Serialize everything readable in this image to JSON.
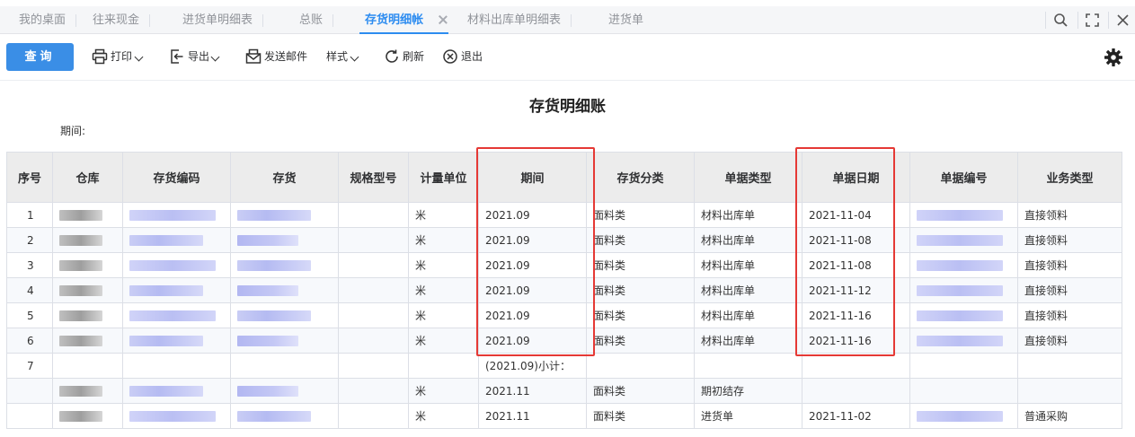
{
  "tabs": [
    {
      "label": "我的桌面"
    },
    {
      "label": "往来现金"
    },
    {
      "label": "进货单明细表"
    },
    {
      "label": "总账"
    },
    {
      "label": "存货明细帐"
    },
    {
      "label": "材料出库单明细表"
    },
    {
      "label": "进货单"
    }
  ],
  "active_tab_index": 4,
  "toolbar": {
    "query": "查询",
    "print": "打印",
    "export": "导出",
    "send_mail": "发送邮件",
    "style": "样式",
    "refresh": "刷新",
    "exit": "退出"
  },
  "report": {
    "title": "存货明细账",
    "period_label": "期间:"
  },
  "table": {
    "headers": [
      "序号",
      "仓库",
      "存货编码",
      "存货",
      "规格型号",
      "计量单位",
      "期间",
      "存货分类",
      "单据类型",
      "单据日期",
      "单据编号",
      "业务类型"
    ],
    "rows": [
      {
        "idx": "1",
        "unit": "米",
        "period": "2021.09",
        "category": "面料类",
        "doc_type": "材料出库单",
        "doc_date": "2021-11-04",
        "biz_type": "直接领料"
      },
      {
        "idx": "2",
        "unit": "米",
        "period": "2021.09",
        "category": "面料类",
        "doc_type": "材料出库单",
        "doc_date": "2021-11-08",
        "biz_type": "直接领料"
      },
      {
        "idx": "3",
        "unit": "米",
        "period": "2021.09",
        "category": "面料类",
        "doc_type": "材料出库单",
        "doc_date": "2021-11-08",
        "biz_type": "直接领料"
      },
      {
        "idx": "4",
        "unit": "米",
        "period": "2021.09",
        "category": "面料类",
        "doc_type": "材料出库单",
        "doc_date": "2021-11-12",
        "biz_type": "直接领料"
      },
      {
        "idx": "5",
        "unit": "米",
        "period": "2021.09",
        "category": "面料类",
        "doc_type": "材料出库单",
        "doc_date": "2021-11-16",
        "biz_type": "直接领料"
      },
      {
        "idx": "6",
        "unit": "米",
        "period": "2021.09",
        "category": "面料类",
        "doc_type": "材料出库单",
        "doc_date": "2021-11-16",
        "biz_type": "直接领料"
      },
      {
        "idx": "7",
        "unit": "",
        "period": "(2021.09)小计：",
        "category": "",
        "doc_type": "",
        "doc_date": "",
        "biz_type": ""
      },
      {
        "idx": "",
        "unit": "米",
        "period": "2021.11",
        "category": "面料类",
        "doc_type": "期初结存",
        "doc_date": "",
        "biz_type": ""
      },
      {
        "idx": "",
        "unit": "米",
        "period": "2021.11",
        "category": "面料类",
        "doc_type": "进货单",
        "doc_date": "2021-11-02",
        "biz_type": "普通采购"
      }
    ]
  },
  "colors": {
    "accent": "#2d8cf0",
    "query_button": "#3a8ee6",
    "highlight": "#e53935",
    "header_bg": "#ececec"
  }
}
